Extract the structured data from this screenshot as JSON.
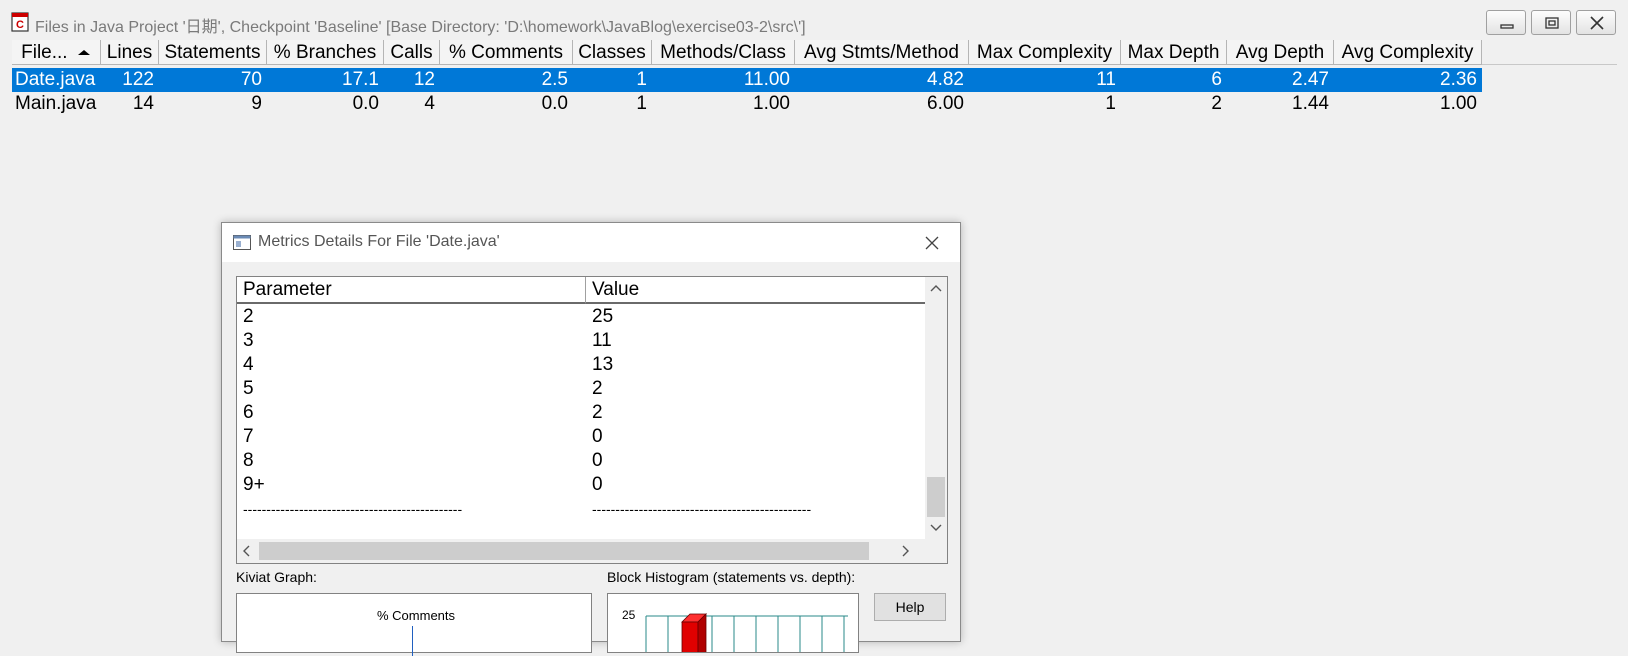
{
  "window": {
    "title": "Files in Java Project '日期', Checkpoint 'Baseline'  [Base Directory: 'D:\\homework\\JavaBlog\\exercise03-2\\src\\']"
  },
  "table": {
    "columns": [
      "File...",
      "Lines",
      "Statements",
      "% Branches",
      "Calls",
      "% Comments",
      "Classes",
      "Methods/Class",
      "Avg Stmts/Method",
      "Max Complexity",
      "Max Depth",
      "Avg Depth",
      "Avg Complexity"
    ],
    "rows": [
      {
        "selected": true,
        "cells": [
          "Date.java",
          "122",
          "70",
          "17.1",
          "12",
          "2.5",
          "1",
          "11.00",
          "4.82",
          "11",
          "6",
          "2.47",
          "2.36"
        ]
      },
      {
        "selected": false,
        "cells": [
          "Main.java",
          "14",
          "9",
          "0.0",
          "4",
          "0.0",
          "1",
          "1.00",
          "6.00",
          "1",
          "2",
          "1.44",
          "1.00"
        ]
      }
    ]
  },
  "dialog": {
    "title": "Metrics Details For File 'Date.java'",
    "columns": [
      "Parameter",
      "Value"
    ],
    "rows": [
      [
        "2",
        "25"
      ],
      [
        "3",
        "11"
      ],
      [
        "4",
        "13"
      ],
      [
        "5",
        "2"
      ],
      [
        "6",
        "2"
      ],
      [
        "7",
        "0"
      ],
      [
        "8",
        "0"
      ],
      [
        "9+",
        "0"
      ],
      [
        "-----------------------------------------------",
        "-----------------------------------------------"
      ]
    ],
    "kiviat_label": "Kiviat Graph:",
    "kiviat_axis_label": "% Comments",
    "histogram_label": "Block Histogram (statements vs. depth):",
    "histogram_tick": "25",
    "help_label": "Help"
  }
}
